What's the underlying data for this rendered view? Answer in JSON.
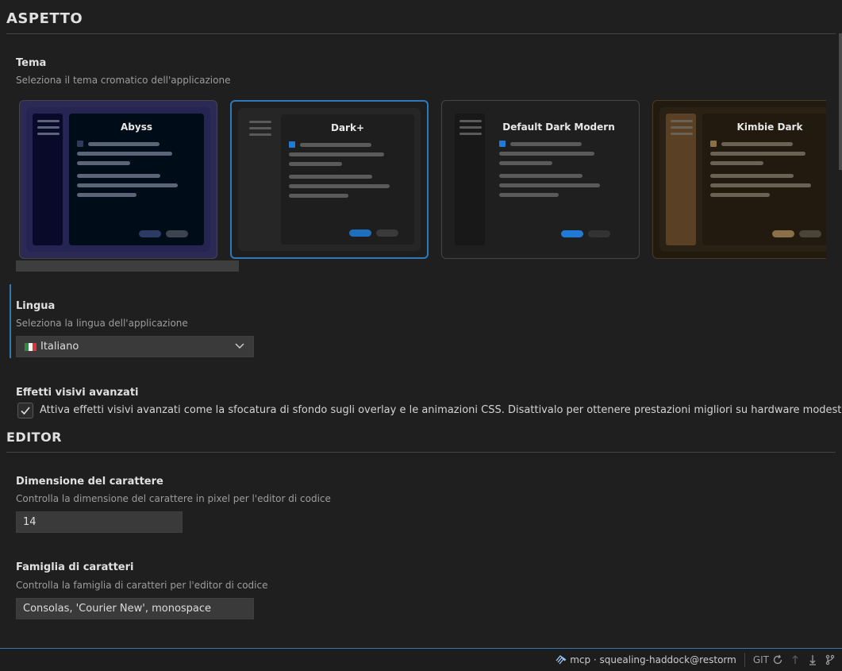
{
  "appearance": {
    "section_title": "ASPETTO",
    "theme": {
      "label": "Tema",
      "description": "Seleziona il tema cromatico dell'applicazione",
      "selected": "Dark+",
      "cards": [
        {
          "name": "Abyss",
          "bg": "#2b2a55",
          "border": "#454545",
          "inner": "#262452",
          "sidebar": "#090a2a",
          "main": "#000c18",
          "accent": "#323a5c",
          "bar": "#5c6478",
          "pill_primary": "#2c3a66",
          "pill_secondary": "#3e4350"
        },
        {
          "name": "Dark+",
          "bg": "#1e1e1e",
          "border": "#2f79b8",
          "inner": "#262626",
          "sidebar": "#262626",
          "main": "#1e1e1e",
          "accent": "#1f7bd6",
          "bar": "#5a5a5a",
          "pill_primary": "#1f6fbf",
          "pill_secondary": "#3a3a3a"
        },
        {
          "name": "Default Dark Modern",
          "bg": "#1f1f1f",
          "border": "#454545",
          "inner": "#1f1f1f",
          "sidebar": "#181818",
          "main": "#1f1f1f",
          "accent": "#1f7bd6",
          "bar": "#5a5a5a",
          "pill_primary": "#1f7bd6",
          "pill_secondary": "#333333"
        },
        {
          "name": "Kimbie Dark",
          "bg": "#221a0f",
          "border": "#4a3a24",
          "inner": "#2a2114",
          "sidebar": "#5a4126",
          "main": "#221a0f",
          "accent": "#8a7048",
          "bar": "#6b6256",
          "pill_primary": "#8a7048",
          "pill_secondary": "#4a4438"
        }
      ]
    },
    "language": {
      "label": "Lingua",
      "description": "Seleziona la lingua dell'applicazione",
      "selected": "Italiano"
    },
    "visual_effects": {
      "label": "Effetti visivi avanzati",
      "checked": true,
      "checkbox_label": "Attiva effetti visivi avanzati come la sfocatura di sfondo sugli overlay e le animazioni CSS. Disattivalo per ottenere prestazioni migliori su hardware modesto."
    }
  },
  "editor": {
    "section_title": "EDITOR",
    "font_size": {
      "label": "Dimensione del carattere",
      "description": "Controlla la dimensione del carattere in pixel per l'editor di codice",
      "value": "14"
    },
    "font_family": {
      "label": "Famiglia di caratteri",
      "description": "Controlla la famiglia di caratteri per l'editor di codice",
      "value": "Consolas, 'Courier New', monospace"
    }
  },
  "statusbar": {
    "connection": "mcp · squealing-haddock@restorm",
    "git_label": "GIT"
  },
  "colors": {
    "accent": "#2f79b8",
    "background": "#1f1f1f"
  }
}
